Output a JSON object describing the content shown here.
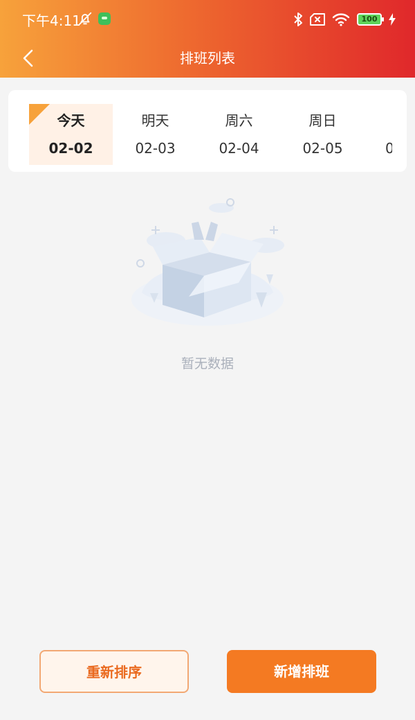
{
  "status_bar": {
    "time": "下午4:11",
    "battery": "100"
  },
  "header": {
    "title": "排班列表"
  },
  "date_tabs": [
    {
      "day": "今天",
      "date": "02-02",
      "active": true
    },
    {
      "day": "明天",
      "date": "02-03",
      "active": false
    },
    {
      "day": "周六",
      "date": "02-04",
      "active": false
    },
    {
      "day": "周日",
      "date": "02-05",
      "active": false
    }
  ],
  "partial_tab_text": "0",
  "empty_state": {
    "text": "暂无数据"
  },
  "actions": {
    "resort_label": "重新排序",
    "add_label": "新增排班"
  },
  "colors": {
    "accent": "#f47a22",
    "header_start": "#f7a23b",
    "header_end": "#e0282b",
    "active_tab_bg": "#fff1e6"
  },
  "icons": [
    "bell-off-icon",
    "app-notification-icon",
    "bluetooth-icon",
    "sim-off-icon",
    "wifi-icon",
    "battery-icon",
    "charging-icon",
    "back-arrow-icon",
    "empty-box-icon"
  ]
}
